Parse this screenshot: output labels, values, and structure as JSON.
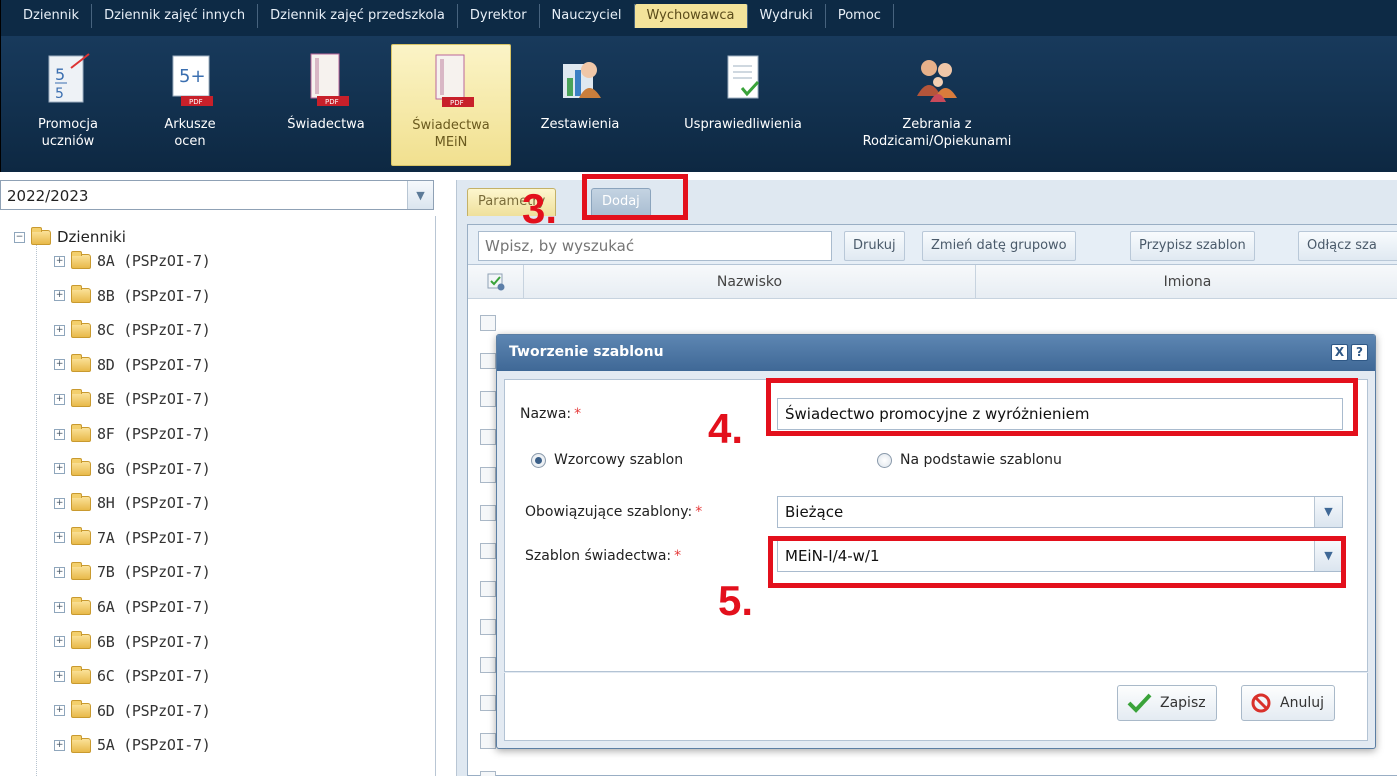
{
  "menu": {
    "tabs": [
      "Dziennik",
      "Dziennik zajęć innych",
      "Dziennik zajęć przedszkola",
      "Dyrektor",
      "Nauczyciel",
      "Wychowawca",
      "Wydruki",
      "Pomoc"
    ],
    "active": "Wychowawca"
  },
  "ribbon": {
    "promocja": "Promocja uczniów",
    "arkusze": "Arkusze ocen",
    "swiadectwa": "Świadectwa",
    "swiadectwa_mein": "Świadectwa MEiN",
    "zestawienia": "Zestawienia",
    "usprawiedliwienia": "Usprawiedliwienia",
    "zebrania": "Zebrania z Rodzicami/Opiekunami",
    "badge_5": "5+",
    "badge_pdf": "PDF"
  },
  "sidebar": {
    "year": "2022/2023",
    "root": "Dzienniki",
    "items": [
      "8A (PSPzOI-7)",
      "8B (PSPzOI-7)",
      "8C (PSPzOI-7)",
      "8D (PSPzOI-7)",
      "8E (PSPzOI-7)",
      "8F (PSPzOI-7)",
      "8G (PSPzOI-7)",
      "8H (PSPzOI-7)",
      "7A (PSPzOI-7)",
      "7B (PSPzOI-7)",
      "6A (PSPzOI-7)",
      "6B (PSPzOI-7)",
      "6C (PSPzOI-7)",
      "6D (PSPzOI-7)",
      "5A (PSPzOI-7)"
    ]
  },
  "main": {
    "tab_params": "Parametry",
    "tab_add": "Dodaj",
    "search_placeholder": "Wpisz, by wyszukać",
    "btn_print": "Drukuj",
    "btn_change_date": "Zmień datę grupowo",
    "btn_assign": "Przypisz szablon",
    "btn_detach": "Odłącz sza",
    "col_surname": "Nazwisko",
    "col_names": "Imiona"
  },
  "dialog": {
    "title": "Tworzenie szablonu",
    "close": "X",
    "help": "?",
    "name_label": "Nazwa:",
    "name_value": "Świadectwo promocyjne z wyróżnieniem",
    "radio_model": "Wzorcowy szablon",
    "radio_based": "Na podstawie szablonu",
    "templates_label": "Obowiązujące szablony:",
    "templates_value": "Bieżące",
    "cert_label": "Szablon świadectwa:",
    "cert_value": "MEiN-I/4-w/1",
    "save": "Zapisz",
    "cancel": "Anuluj",
    "required_mark": "*"
  },
  "annotations": {
    "step3": "3.",
    "step4": "4.",
    "step5": "5."
  },
  "colors": {
    "menubar": "#0d2a45",
    "active_tab": "#f3e39a",
    "dialog_header": "#4a73a0",
    "annotation": "#e3101c"
  }
}
